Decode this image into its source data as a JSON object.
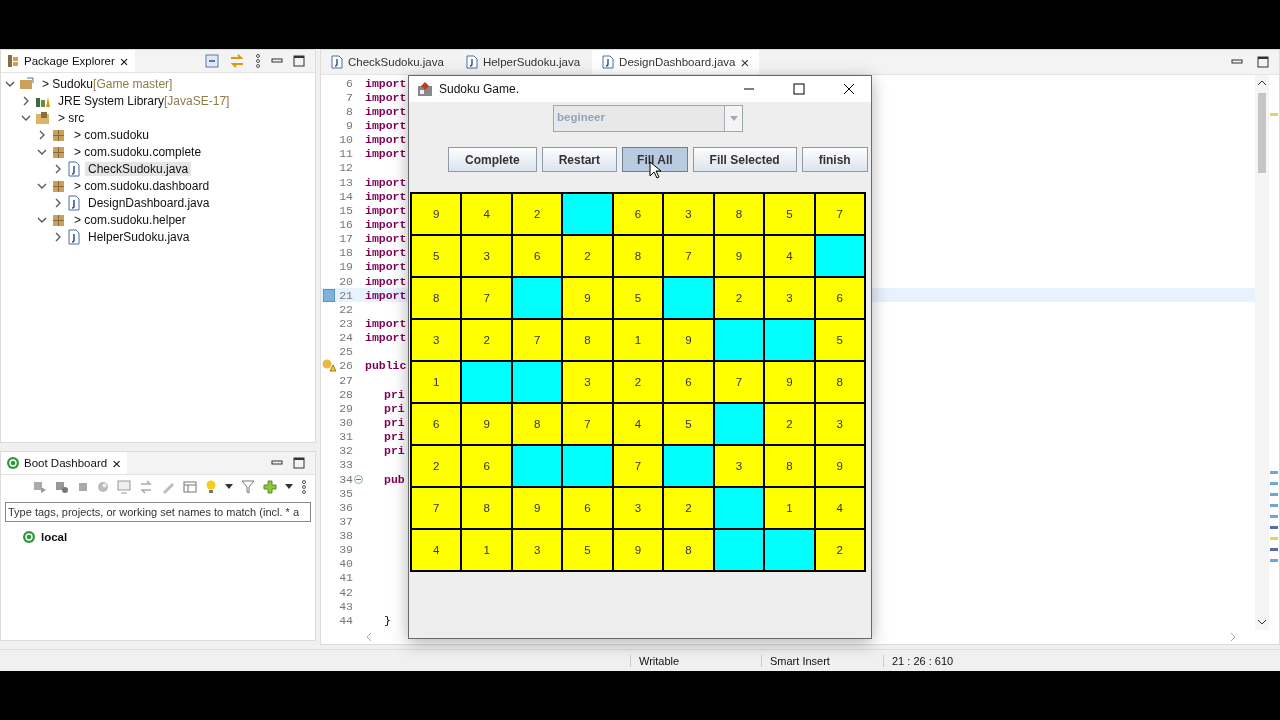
{
  "package_explorer": {
    "title": "Package Explorer",
    "close": "×",
    "tree": [
      {
        "kind": "project",
        "label": "> Sudoku",
        "decoration": "[Game master]",
        "expanded": true,
        "selected": false,
        "children": [
          {
            "kind": "library",
            "label": "JRE System Library",
            "decoration": "[JavaSE-17]",
            "expanded": false,
            "selected": false
          },
          {
            "kind": "folder",
            "label": "> src",
            "expanded": true,
            "selected": false,
            "children": [
              {
                "kind": "package",
                "label": "> com.sudoku",
                "expanded": false,
                "selected": false
              },
              {
                "kind": "package",
                "label": "> com.sudoku.complete",
                "expanded": true,
                "selected": false,
                "children": [
                  {
                    "kind": "file",
                    "label": "CheckSudoku.java",
                    "expanded": false,
                    "selected": true
                  }
                ]
              },
              {
                "kind": "package",
                "label": "> com.sudoku.dashboard",
                "expanded": true,
                "selected": false,
                "children": [
                  {
                    "kind": "file",
                    "label": "DesignDashboard.java",
                    "expanded": false,
                    "selected": false
                  }
                ]
              },
              {
                "kind": "package",
                "label": "> com.sudoku.helper",
                "expanded": true,
                "selected": false,
                "children": [
                  {
                    "kind": "file",
                    "label": "HelperSudoku.java",
                    "expanded": false,
                    "selected": false
                  }
                ]
              }
            ]
          }
        ]
      }
    ]
  },
  "boot_dashboard": {
    "title": "Boot Dashboard",
    "close": "×",
    "filter": {
      "placeholder": "Type tags, projects, or working set names to match (incl. * a"
    },
    "items": [
      {
        "label": "local"
      }
    ]
  },
  "editor": {
    "tabs": [
      {
        "label": "CheckSudoku.java",
        "selected": false
      },
      {
        "label": "HelperSudoku.java",
        "selected": false
      },
      {
        "label": "DesignDashboard.java",
        "selected": true,
        "close": "×"
      }
    ],
    "lines": [
      {
        "number": "6",
        "kind": "top",
        "text": "import",
        "keyword": true,
        "current": false
      },
      {
        "number": "7",
        "kind": "top",
        "text": "import",
        "keyword": true,
        "current": false
      },
      {
        "number": "8",
        "kind": "top",
        "text": "import",
        "keyword": true,
        "current": false
      },
      {
        "number": "9",
        "kind": "top",
        "text": "import",
        "keyword": true,
        "current": false
      },
      {
        "number": "10",
        "kind": "top",
        "text": "import",
        "keyword": true,
        "current": false
      },
      {
        "number": "11",
        "kind": "top",
        "text": "import",
        "keyword": true,
        "current": false
      },
      {
        "number": "12",
        "kind": "blank",
        "current": false
      },
      {
        "number": "13",
        "kind": "top",
        "text": "import",
        "keyword": true,
        "current": false
      },
      {
        "number": "14",
        "kind": "top",
        "text": "import",
        "keyword": true,
        "current": false
      },
      {
        "number": "15",
        "kind": "top",
        "text": "import",
        "keyword": true,
        "current": false
      },
      {
        "number": "16",
        "kind": "top",
        "text": "import",
        "keyword": true,
        "current": false
      },
      {
        "number": "17",
        "kind": "top",
        "text": "import",
        "keyword": true,
        "current": false
      },
      {
        "number": "18",
        "kind": "top",
        "text": "import",
        "keyword": true,
        "current": false
      },
      {
        "number": "19",
        "kind": "top",
        "text": "import",
        "keyword": true,
        "current": false
      },
      {
        "number": "20",
        "kind": "top",
        "text": "import",
        "keyword": true,
        "current": false
      },
      {
        "number": "21",
        "kind": "top",
        "text": "import",
        "keyword": true,
        "current": true,
        "marker": {
          "kind": "bookmark"
        }
      },
      {
        "number": "22",
        "kind": "blank",
        "current": false
      },
      {
        "number": "23",
        "kind": "top",
        "text": "import",
        "keyword": true,
        "current": false
      },
      {
        "number": "24",
        "kind": "top",
        "text": "import",
        "keyword": true,
        "current": false
      },
      {
        "number": "25",
        "kind": "blank",
        "current": false
      },
      {
        "number": "26",
        "kind": "top",
        "text": "public",
        "keyword": true,
        "current": false,
        "marker": {
          "kind": "warning"
        }
      },
      {
        "number": "27",
        "kind": "blank",
        "current": false
      },
      {
        "number": "28",
        "kind": "member",
        "text": "pri",
        "keyword": true,
        "current": false
      },
      {
        "number": "29",
        "kind": "member",
        "text": "pri",
        "keyword": true,
        "current": false
      },
      {
        "number": "30",
        "kind": "member",
        "text": "pri",
        "keyword": true,
        "current": false
      },
      {
        "number": "31",
        "kind": "member",
        "text": "pri",
        "keyword": true,
        "current": false
      },
      {
        "number": "32",
        "kind": "member",
        "text": "pri",
        "keyword": true,
        "current": false
      },
      {
        "number": "33",
        "kind": "blank",
        "current": false
      },
      {
        "number": "34",
        "kind": "member",
        "text": "pub",
        "keyword": true,
        "current": false,
        "marker": {
          "kind": "fold"
        }
      },
      {
        "number": "35",
        "kind": "blank",
        "current": false
      },
      {
        "number": "36",
        "kind": "blank",
        "current": false
      },
      {
        "number": "37",
        "kind": "blank",
        "current": false
      },
      {
        "number": "38",
        "kind": "blank",
        "current": false
      },
      {
        "number": "39",
        "kind": "blank",
        "current": false
      },
      {
        "number": "40",
        "kind": "blank",
        "current": false
      },
      {
        "number": "41",
        "kind": "blank",
        "current": false
      },
      {
        "number": "42",
        "kind": "blank",
        "current": false
      },
      {
        "number": "43",
        "kind": "blank",
        "current": false
      },
      {
        "number": "44",
        "kind": "member",
        "text": "}",
        "keyword": false,
        "current": false
      }
    ]
  },
  "sudoku_window": {
    "title": "Sudoku Game.",
    "level_select": {
      "value": "begineer",
      "disabled": true
    },
    "buttons": [
      {
        "label": "Complete",
        "pressed": false
      },
      {
        "label": "Restart",
        "pressed": false
      },
      {
        "label": "Fill All",
        "pressed": true
      },
      {
        "label": "Fill Selected",
        "pressed": false
      },
      {
        "label": "finish",
        "pressed": false
      }
    ],
    "grid": [
      [
        {
          "kind": "filled",
          "value": "9"
        },
        {
          "kind": "filled",
          "value": "4"
        },
        {
          "kind": "filled",
          "value": "2"
        },
        {
          "kind": "empty"
        },
        {
          "kind": "filled",
          "value": "6"
        },
        {
          "kind": "filled",
          "value": "3"
        },
        {
          "kind": "filled",
          "value": "8"
        },
        {
          "kind": "filled",
          "value": "5"
        },
        {
          "kind": "filled",
          "value": "7"
        }
      ],
      [
        {
          "kind": "filled",
          "value": "5"
        },
        {
          "kind": "filled",
          "value": "3"
        },
        {
          "kind": "filled",
          "value": "6"
        },
        {
          "kind": "filled",
          "value": "2"
        },
        {
          "kind": "filled",
          "value": "8"
        },
        {
          "kind": "filled",
          "value": "7"
        },
        {
          "kind": "filled",
          "value": "9"
        },
        {
          "kind": "filled",
          "value": "4"
        },
        {
          "kind": "empty"
        }
      ],
      [
        {
          "kind": "filled",
          "value": "8"
        },
        {
          "kind": "filled",
          "value": "7"
        },
        {
          "kind": "empty"
        },
        {
          "kind": "filled",
          "value": "9"
        },
        {
          "kind": "filled",
          "value": "5"
        },
        {
          "kind": "empty"
        },
        {
          "kind": "filled",
          "value": "2"
        },
        {
          "kind": "filled",
          "value": "3"
        },
        {
          "kind": "filled",
          "value": "6"
        }
      ],
      [
        {
          "kind": "filled",
          "value": "3"
        },
        {
          "kind": "filled",
          "value": "2"
        },
        {
          "kind": "filled",
          "value": "7"
        },
        {
          "kind": "filled",
          "value": "8"
        },
        {
          "kind": "filled",
          "value": "1"
        },
        {
          "kind": "filled",
          "value": "9"
        },
        {
          "kind": "empty"
        },
        {
          "kind": "empty"
        },
        {
          "kind": "filled",
          "value": "5"
        }
      ],
      [
        {
          "kind": "filled",
          "value": "1"
        },
        {
          "kind": "empty"
        },
        {
          "kind": "empty"
        },
        {
          "kind": "filled",
          "value": "3"
        },
        {
          "kind": "filled",
          "value": "2"
        },
        {
          "kind": "filled",
          "value": "6"
        },
        {
          "kind": "filled",
          "value": "7"
        },
        {
          "kind": "filled",
          "value": "9"
        },
        {
          "kind": "filled",
          "value": "8"
        }
      ],
      [
        {
          "kind": "filled",
          "value": "6"
        },
        {
          "kind": "filled",
          "value": "9"
        },
        {
          "kind": "filled",
          "value": "8"
        },
        {
          "kind": "filled",
          "value": "7"
        },
        {
          "kind": "filled",
          "value": "4"
        },
        {
          "kind": "filled",
          "value": "5"
        },
        {
          "kind": "empty"
        },
        {
          "kind": "filled",
          "value": "2"
        },
        {
          "kind": "filled",
          "value": "3"
        }
      ],
      [
        {
          "kind": "filled",
          "value": "2"
        },
        {
          "kind": "filled",
          "value": "6"
        },
        {
          "kind": "empty"
        },
        {
          "kind": "empty"
        },
        {
          "kind": "filled",
          "value": "7"
        },
        {
          "kind": "empty"
        },
        {
          "kind": "filled",
          "value": "3"
        },
        {
          "kind": "filled",
          "value": "8"
        },
        {
          "kind": "filled",
          "value": "9"
        }
      ],
      [
        {
          "kind": "filled",
          "value": "7"
        },
        {
          "kind": "filled",
          "value": "8"
        },
        {
          "kind": "filled",
          "value": "9"
        },
        {
          "kind": "filled",
          "value": "6"
        },
        {
          "kind": "filled",
          "value": "3"
        },
        {
          "kind": "filled",
          "value": "2"
        },
        {
          "kind": "empty"
        },
        {
          "kind": "filled",
          "value": "1"
        },
        {
          "kind": "filled",
          "value": "4"
        }
      ],
      [
        {
          "kind": "filled",
          "value": "4"
        },
        {
          "kind": "filled",
          "value": "1"
        },
        {
          "kind": "filled",
          "value": "3"
        },
        {
          "kind": "filled",
          "value": "5"
        },
        {
          "kind": "filled",
          "value": "9"
        },
        {
          "kind": "filled",
          "value": "8"
        },
        {
          "kind": "empty"
        },
        {
          "kind": "empty"
        },
        {
          "kind": "filled",
          "value": "2"
        }
      ]
    ]
  },
  "status_bar": {
    "mode": "Writable",
    "insert": "Smart Insert",
    "position": "21 : 26 : 610"
  }
}
